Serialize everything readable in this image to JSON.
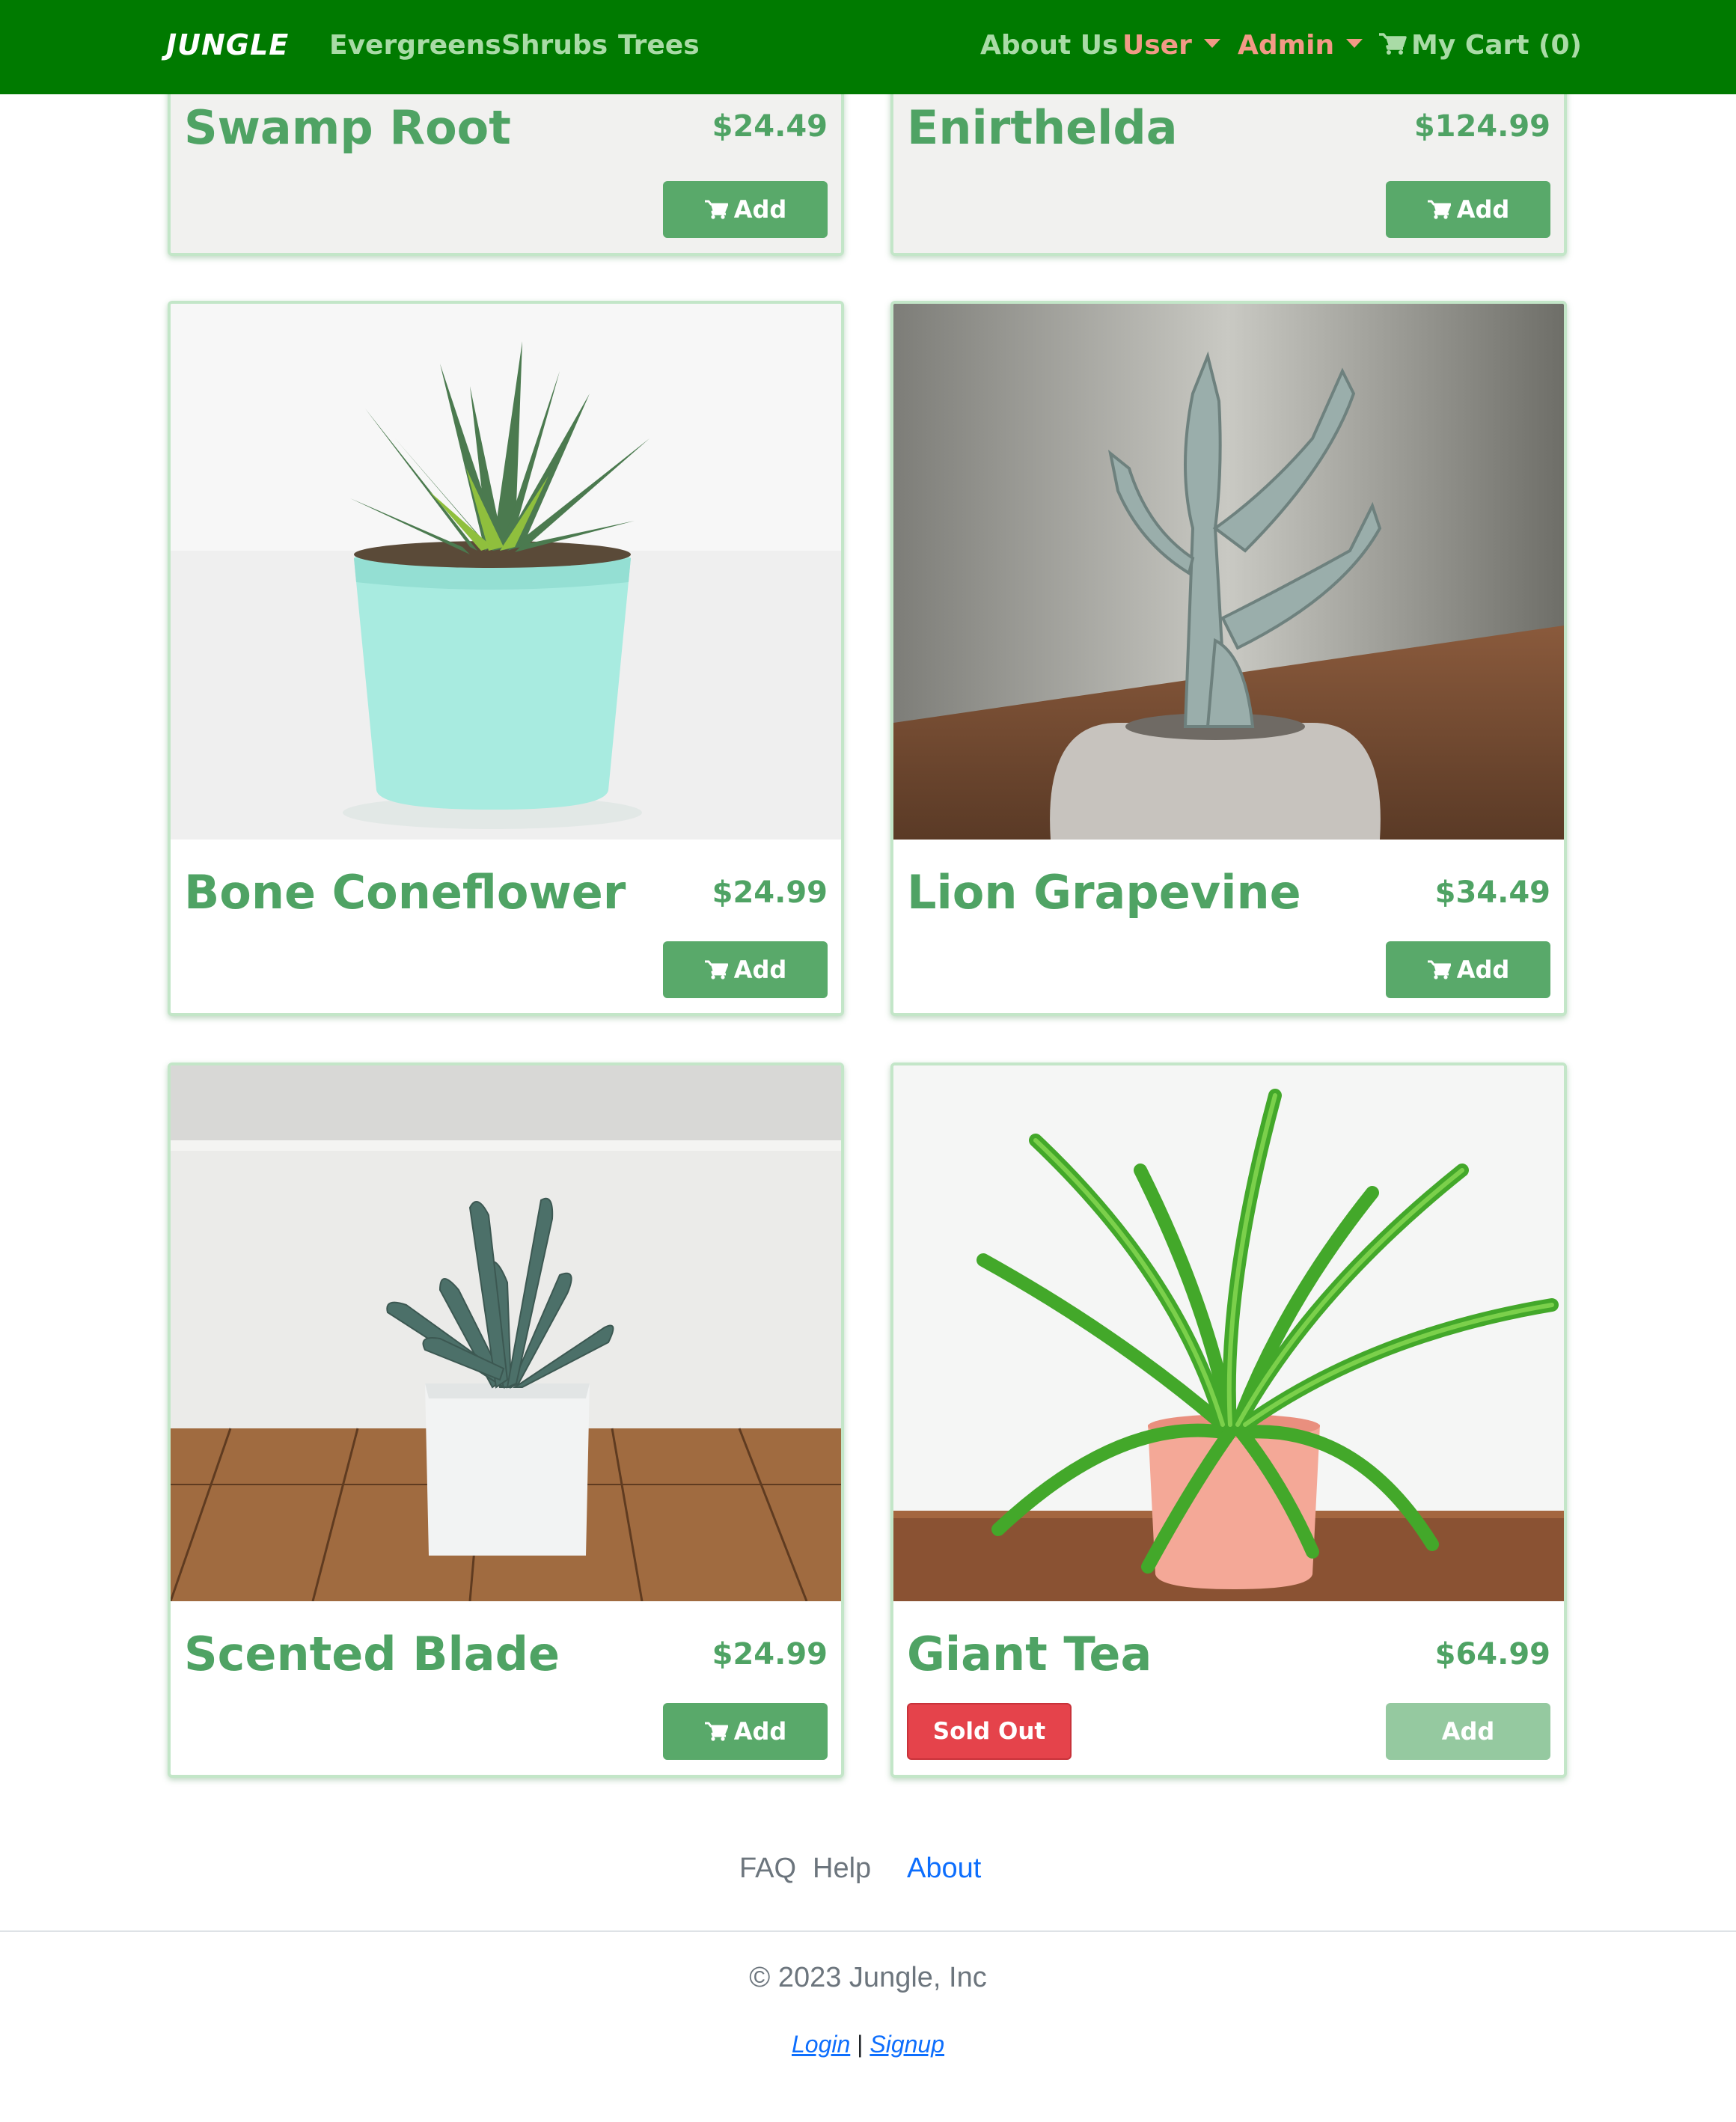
{
  "navbar": {
    "brand": "JUNGLE",
    "links": [
      "Evergreens",
      "Shrubs",
      "Trees"
    ],
    "about": "About Us",
    "user": "User",
    "admin": "Admin",
    "cart": "My Cart (0)"
  },
  "products": [
    {
      "name": "Swamp Root",
      "price": "$24.49",
      "add_label": "Add",
      "sold_out": false
    },
    {
      "name": "Enirthelda",
      "price": "$124.99",
      "add_label": "Add",
      "sold_out": false
    },
    {
      "name": "Bone Coneflower",
      "price": "$24.99",
      "add_label": "Add",
      "sold_out": false,
      "image": "succulent-in-mint-pot"
    },
    {
      "name": "Lion Grapevine",
      "price": "$34.49",
      "add_label": "Add",
      "sold_out": false,
      "image": "cactus-in-stone-pot"
    },
    {
      "name": "Scented Blade",
      "price": "$24.99",
      "add_label": "Add",
      "sold_out": false,
      "image": "succulent-in-white-pot"
    },
    {
      "name": "Giant Tea",
      "price": "$64.99",
      "add_label": "Add",
      "sold_out": true,
      "sold_out_label": "Sold Out",
      "image": "fern-in-pink-pot"
    }
  ],
  "footer": {
    "links": [
      "FAQ",
      "Help",
      "About"
    ],
    "copyright": "© 2023 Jungle, Inc",
    "login": "Login",
    "separator": "|",
    "signup": "Signup"
  },
  "colors": {
    "navbar": "#007a00",
    "accent_green": "#4fa364",
    "button_green": "#59a96a",
    "sold_out_red": "#e5434b",
    "nav_orange": "#f29a86"
  }
}
